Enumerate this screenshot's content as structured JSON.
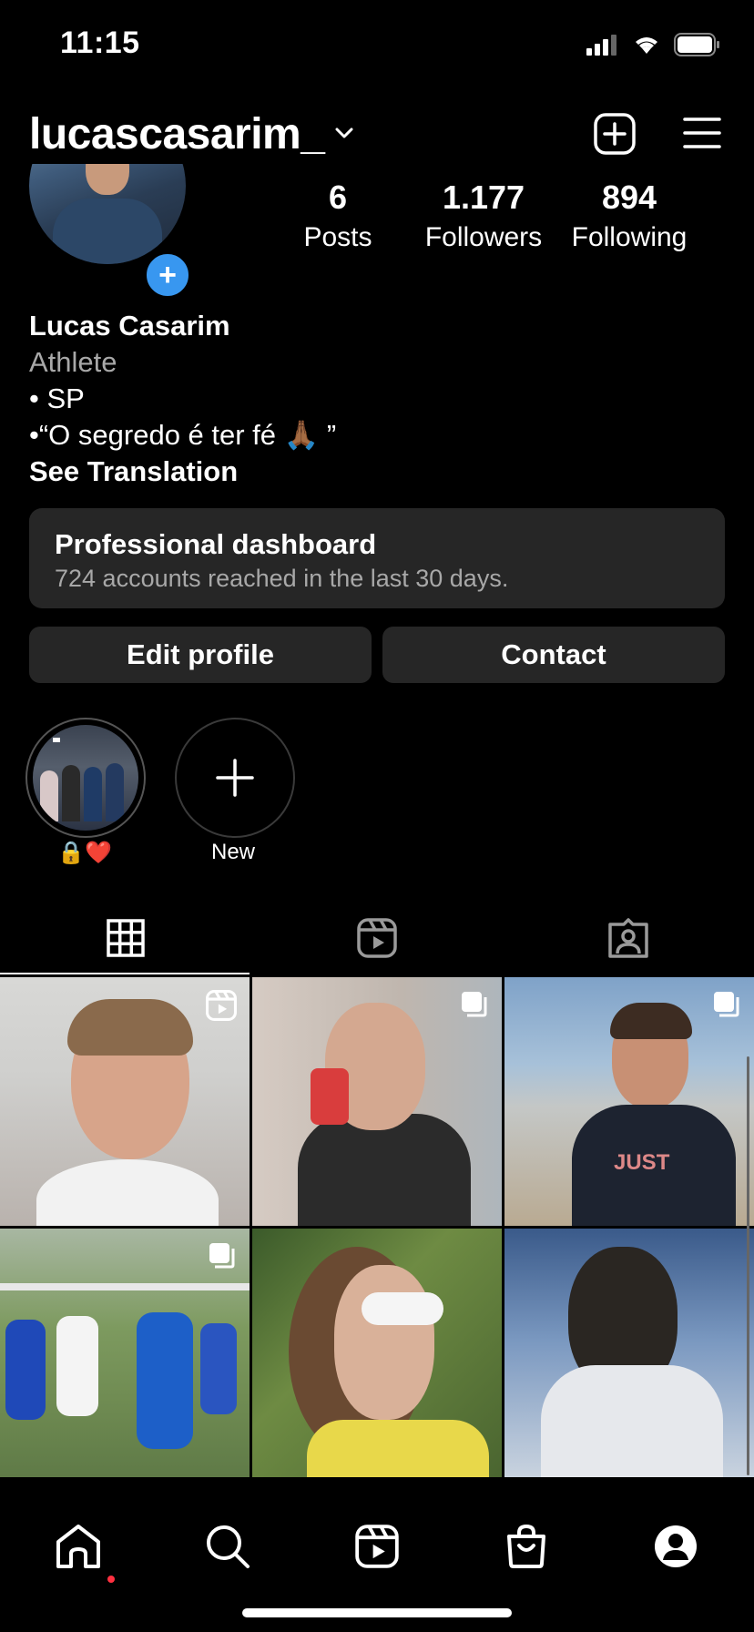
{
  "status_bar": {
    "time": "11:15"
  },
  "header": {
    "username": "lucascasarim_"
  },
  "stats": [
    {
      "value": "6",
      "label": "Posts"
    },
    {
      "value": "1.177",
      "label": "Followers"
    },
    {
      "value": "894",
      "label": "Following"
    }
  ],
  "bio": {
    "name": "Lucas Casarim",
    "category": "Athlete",
    "line1": "• SP",
    "line2": "•“O segredo é ter fé 🙏🏾 ”",
    "see_translation": "See Translation"
  },
  "dashboard": {
    "title": "Professional dashboard",
    "subtitle": "724 accounts reached in the last 30 days."
  },
  "buttons": {
    "edit": "Edit profile",
    "contact": "Contact"
  },
  "highlights": [
    {
      "label": "🔒❤️"
    },
    {
      "label": "New"
    }
  ],
  "tabs": [
    "grid-icon",
    "reels-icon",
    "tagged-icon"
  ],
  "posts": [
    {
      "type": "reel"
    },
    {
      "type": "carousel"
    },
    {
      "type": "carousel"
    },
    {
      "type": "carousel"
    },
    {
      "type": "photo"
    },
    {
      "type": "photo"
    }
  ],
  "bottom_nav": [
    "home-icon",
    "search-icon",
    "reels-icon",
    "shop-icon",
    "profile-icon"
  ],
  "colors": {
    "accent": "#3897f0",
    "notification": "#ff3040",
    "card": "#262626"
  }
}
